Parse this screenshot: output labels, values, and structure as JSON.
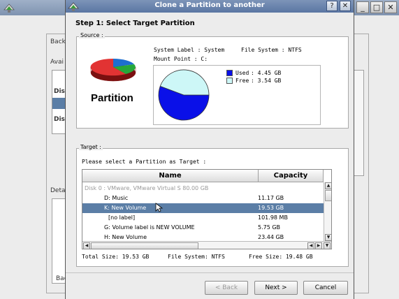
{
  "colors": {
    "used": "#0a10e8",
    "free": "#cdf7f7",
    "selection": "#5b7ea6",
    "titlebar": "#6682ad"
  },
  "background_window": {
    "labels": [
      "Back",
      "Avai",
      "Dis",
      "Dis",
      "Deta",
      "Back"
    ],
    "win_buttons": [
      "_",
      "□",
      "✕"
    ]
  },
  "dialog": {
    "title": "Clone a Partition to another",
    "title_buttons": [
      "?",
      "✕"
    ],
    "step_title": "Step 1: Select Target Partition",
    "source": {
      "group_label": "Source :",
      "logo_text": "Partition",
      "system_label": "System Label : System",
      "file_system": "File  System : NTFS",
      "mount_point": "Mount  Point : C:",
      "legend": [
        {
          "name": "Used",
          "value": ": 4.45 GB",
          "color": "#0a10e8",
          "fraction": 0.557
        },
        {
          "name": "Free",
          "value": ": 3.54 GB",
          "color": "#cdf7f7",
          "fraction": 0.443
        }
      ]
    },
    "target": {
      "group_label": "Target :",
      "instruction": "Please select a Partition as Target :",
      "columns": [
        "Name",
        "Capacity"
      ],
      "disk_row": "Disk 0 : VMware, VMware Virtual S  80.00 GB",
      "rows": [
        {
          "name": "D: Music",
          "capacity": "11.17 GB",
          "selected": false
        },
        {
          "name": "K: New Volume",
          "capacity": "19.53 GB",
          "selected": true
        },
        {
          "name": "[no label]",
          "capacity": "101.98 MB",
          "selected": false
        },
        {
          "name": "G:  Volume label is NEW VOLUME",
          "capacity": "5.75 GB",
          "selected": false
        },
        {
          "name": "H: New Volume",
          "capacity": "23.44 GB",
          "selected": false
        }
      ],
      "total_size": "Total Size: 19.53 GB",
      "file_system": "File System: NTFS",
      "free_size": "Free  Size: 19.48 GB"
    },
    "buttons": {
      "back": "< Back",
      "next": "Next >",
      "cancel": "Cancel"
    }
  }
}
